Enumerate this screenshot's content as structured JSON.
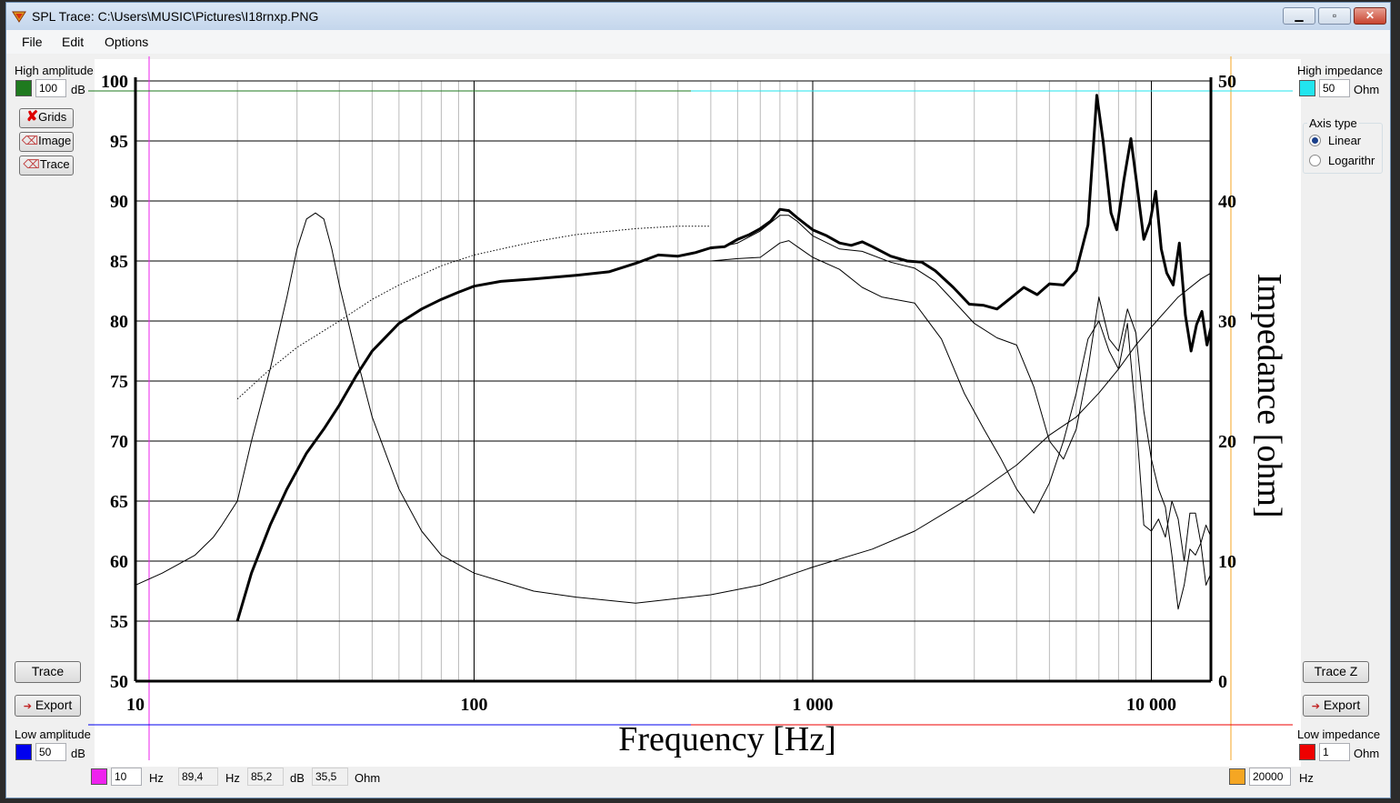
{
  "window": {
    "title": "SPL Trace: C:\\Users\\MUSIC\\Pictures\\I18rnxp.PNG",
    "minimize_glyph": "▁",
    "maximize_glyph": "▫",
    "close_glyph": "✕"
  },
  "menu": {
    "file": "File",
    "edit": "Edit",
    "options": "Options"
  },
  "left_panel": {
    "high_amplitude_label": "High amplitude",
    "high_amplitude_value": "100",
    "high_amplitude_unit": "dB",
    "high_amplitude_color": "#1f7a1f",
    "grids_button": "Grids",
    "image_button": "Image",
    "trace_tool_button": "Trace",
    "trace_button": "Trace",
    "export_button": "Export",
    "low_amplitude_label": "Low amplitude",
    "low_amplitude_value": "50",
    "low_amplitude_unit": "dB",
    "low_amplitude_color": "#0000ee"
  },
  "right_panel": {
    "high_impedance_label": "High impedance",
    "high_impedance_value": "50",
    "high_impedance_unit": "Ohm",
    "high_impedance_color": "#22e5ee",
    "axis_type_label": "Axis type",
    "axis_linear": "Linear",
    "axis_log": "Logarithr",
    "axis_selected": "Linear",
    "trace_z_button": "Trace Z",
    "export_button": "Export",
    "low_impedance_label": "Low impedance",
    "low_impedance_value": "1",
    "low_impedance_unit": "Ohm",
    "low_impedance_color": "#ee0000"
  },
  "bottom_bar": {
    "low_freq_color": "#ee22ee",
    "low_freq_value": "10",
    "low_freq_unit": "Hz",
    "cursor_freq": "89,4",
    "cursor_freq_unit": "Hz",
    "cursor_spl": "85,2",
    "cursor_spl_unit": "dB",
    "cursor_impedance": "35,5",
    "cursor_impedance_unit": "Ohm",
    "high_freq_color": "#f5a623",
    "high_freq_value": "20000",
    "high_freq_unit": "Hz"
  },
  "chart_data": {
    "type": "line",
    "xlabel": "Frequency [Hz]",
    "y2label": "Impedance [ohm]",
    "x_scale": "log",
    "xlim": [
      10,
      15000
    ],
    "ylim": [
      50,
      100
    ],
    "y2lim": [
      0,
      50
    ],
    "x_tick_labels": [
      "10",
      "100",
      "1 000",
      "10 000"
    ],
    "y_tick_labels": [
      "100",
      "95",
      "90",
      "85",
      "80",
      "75",
      "70",
      "65",
      "60",
      "55",
      "50"
    ],
    "y2_tick_labels": [
      "50",
      "40",
      "30",
      "20",
      "10",
      "0"
    ],
    "grid": true,
    "series": [
      {
        "style": "bold",
        "axis": "y",
        "points": [
          [
            20,
            55
          ],
          [
            22,
            59
          ],
          [
            25,
            63
          ],
          [
            28,
            66
          ],
          [
            32,
            69
          ],
          [
            36,
            71
          ],
          [
            40,
            73
          ],
          [
            45,
            75.5
          ],
          [
            50,
            77.5
          ],
          [
            60,
            79.8
          ],
          [
            70,
            81
          ],
          [
            80,
            81.8
          ],
          [
            90,
            82.4
          ],
          [
            100,
            82.9
          ],
          [
            120,
            83.3
          ],
          [
            150,
            83.5
          ],
          [
            200,
            83.8
          ],
          [
            250,
            84.1
          ],
          [
            300,
            84.8
          ],
          [
            350,
            85.5
          ],
          [
            400,
            85.4
          ],
          [
            450,
            85.7
          ],
          [
            500,
            86.1
          ],
          [
            550,
            86.2
          ],
          [
            600,
            86.8
          ],
          [
            650,
            87.2
          ],
          [
            700,
            87.7
          ],
          [
            750,
            88.3
          ],
          [
            800,
            89.3
          ],
          [
            850,
            89.2
          ],
          [
            900,
            88.6
          ],
          [
            1000,
            87.6
          ],
          [
            1100,
            87.1
          ],
          [
            1200,
            86.5
          ],
          [
            1300,
            86.3
          ],
          [
            1400,
            86.6
          ],
          [
            1500,
            86.2
          ],
          [
            1700,
            85.4
          ],
          [
            1900,
            85.0
          ],
          [
            2100,
            84.9
          ],
          [
            2300,
            84.2
          ],
          [
            2600,
            82.8
          ],
          [
            2900,
            81.4
          ],
          [
            3200,
            81.3
          ],
          [
            3500,
            81.0
          ],
          [
            3800,
            81.8
          ],
          [
            4200,
            82.8
          ],
          [
            4600,
            82.2
          ],
          [
            5000,
            83.1
          ],
          [
            5500,
            83.0
          ],
          [
            6000,
            84.2
          ],
          [
            6500,
            88.0
          ],
          [
            6900,
            98.8
          ],
          [
            7200,
            95.0
          ],
          [
            7600,
            89.0
          ],
          [
            7900,
            87.6
          ],
          [
            8300,
            91.8
          ],
          [
            8700,
            95.2
          ],
          [
            9100,
            91.0
          ],
          [
            9500,
            86.8
          ],
          [
            9900,
            88.2
          ],
          [
            10300,
            90.8
          ],
          [
            10700,
            86.0
          ],
          [
            11100,
            84.0
          ],
          [
            11600,
            83.0
          ],
          [
            12100,
            86.5
          ],
          [
            12600,
            80.5
          ],
          [
            13100,
            77.5
          ],
          [
            13600,
            79.7
          ],
          [
            14100,
            80.8
          ],
          [
            14600,
            78.0
          ],
          [
            15000,
            79.5
          ]
        ]
      },
      {
        "style": "thin",
        "axis": "y",
        "points": [
          [
            500,
            86.0
          ],
          [
            600,
            86.5
          ],
          [
            700,
            87.5
          ],
          [
            800,
            88.8
          ],
          [
            850,
            88.8
          ],
          [
            900,
            88.3
          ],
          [
            1000,
            87.1
          ],
          [
            1200,
            86.0
          ],
          [
            1400,
            85.8
          ],
          [
            1700,
            84.9
          ],
          [
            2000,
            84.4
          ],
          [
            2300,
            83.3
          ],
          [
            2600,
            81.7
          ],
          [
            3000,
            79.8
          ],
          [
            3500,
            78.6
          ],
          [
            4000,
            78.0
          ],
          [
            4500,
            74.5
          ],
          [
            5000,
            70.0
          ],
          [
            5500,
            68.5
          ],
          [
            6000,
            71.0
          ],
          [
            6500,
            76.0
          ],
          [
            7000,
            82.0
          ],
          [
            7500,
            78.5
          ],
          [
            8000,
            77.5
          ],
          [
            8500,
            81.0
          ],
          [
            9000,
            79.0
          ],
          [
            9500,
            72.5
          ],
          [
            10000,
            68.5
          ],
          [
            10500,
            66.0
          ],
          [
            11000,
            64.5
          ],
          [
            11500,
            60.5
          ],
          [
            12000,
            56.0
          ],
          [
            12500,
            58.0
          ],
          [
            13000,
            61.0
          ],
          [
            13500,
            60.5
          ],
          [
            14000,
            61.5
          ],
          [
            14500,
            58.0
          ],
          [
            15000,
            59.0
          ]
        ]
      },
      {
        "style": "thin",
        "axis": "y",
        "points": [
          [
            500,
            85.0
          ],
          [
            600,
            85.2
          ],
          [
            700,
            85.3
          ],
          [
            800,
            86.5
          ],
          [
            850,
            86.7
          ],
          [
            900,
            86.2
          ],
          [
            1000,
            85.3
          ],
          [
            1200,
            84.3
          ],
          [
            1400,
            82.8
          ],
          [
            1600,
            82.0
          ],
          [
            2000,
            81.5
          ],
          [
            2400,
            78.5
          ],
          [
            2800,
            74.0
          ],
          [
            3200,
            71.0
          ],
          [
            3600,
            68.5
          ],
          [
            4000,
            66.0
          ],
          [
            4500,
            64.0
          ],
          [
            5000,
            66.5
          ],
          [
            5500,
            70.0
          ],
          [
            6000,
            74.0
          ],
          [
            6500,
            78.5
          ],
          [
            7000,
            80.0
          ],
          [
            7500,
            77.5
          ],
          [
            8000,
            76.0
          ],
          [
            8500,
            79.8
          ],
          [
            9000,
            72.0
          ],
          [
            9500,
            63.0
          ],
          [
            10000,
            62.5
          ],
          [
            10500,
            63.5
          ],
          [
            11000,
            62.0
          ],
          [
            11500,
            65.0
          ],
          [
            12000,
            63.5
          ],
          [
            12500,
            60.0
          ],
          [
            13000,
            64.0
          ],
          [
            13500,
            64.0
          ],
          [
            14000,
            61.5
          ],
          [
            14500,
            63.0
          ],
          [
            15000,
            62.0
          ]
        ]
      },
      {
        "style": "thin",
        "axis": "y2",
        "points": [
          [
            10,
            8
          ],
          [
            12,
            9
          ],
          [
            15,
            10.5
          ],
          [
            17,
            12
          ],
          [
            18,
            13
          ],
          [
            20,
            15
          ],
          [
            22,
            20
          ],
          [
            25,
            26
          ],
          [
            28,
            32
          ],
          [
            30,
            36
          ],
          [
            32,
            38.5
          ],
          [
            34,
            39
          ],
          [
            36,
            38.5
          ],
          [
            38,
            36
          ],
          [
            40,
            33
          ],
          [
            45,
            27
          ],
          [
            50,
            22
          ],
          [
            60,
            16
          ],
          [
            70,
            12.5
          ],
          [
            80,
            10.5
          ],
          [
            100,
            9
          ],
          [
            150,
            7.5
          ],
          [
            200,
            7
          ],
          [
            300,
            6.5
          ],
          [
            500,
            7.2
          ],
          [
            700,
            8
          ],
          [
            1000,
            9.5
          ],
          [
            1500,
            11
          ],
          [
            2000,
            12.5
          ],
          [
            3000,
            15.5
          ],
          [
            4000,
            18
          ],
          [
            5000,
            20.5
          ],
          [
            6000,
            22
          ],
          [
            7000,
            24
          ],
          [
            8000,
            26
          ],
          [
            9000,
            28
          ],
          [
            10000,
            29.5
          ],
          [
            12000,
            32
          ],
          [
            14000,
            33.5
          ],
          [
            15000,
            34
          ]
        ]
      },
      {
        "style": "dotted",
        "axis": "y",
        "points": [
          [
            20,
            73.5
          ],
          [
            25,
            76
          ],
          [
            30,
            77.8
          ],
          [
            40,
            80
          ],
          [
            50,
            81.8
          ],
          [
            60,
            83
          ],
          [
            80,
            84.6
          ],
          [
            100,
            85.5
          ],
          [
            150,
            86.6
          ],
          [
            200,
            87.2
          ],
          [
            300,
            87.7
          ],
          [
            400,
            87.9
          ],
          [
            500,
            87.9
          ]
        ]
      }
    ]
  }
}
